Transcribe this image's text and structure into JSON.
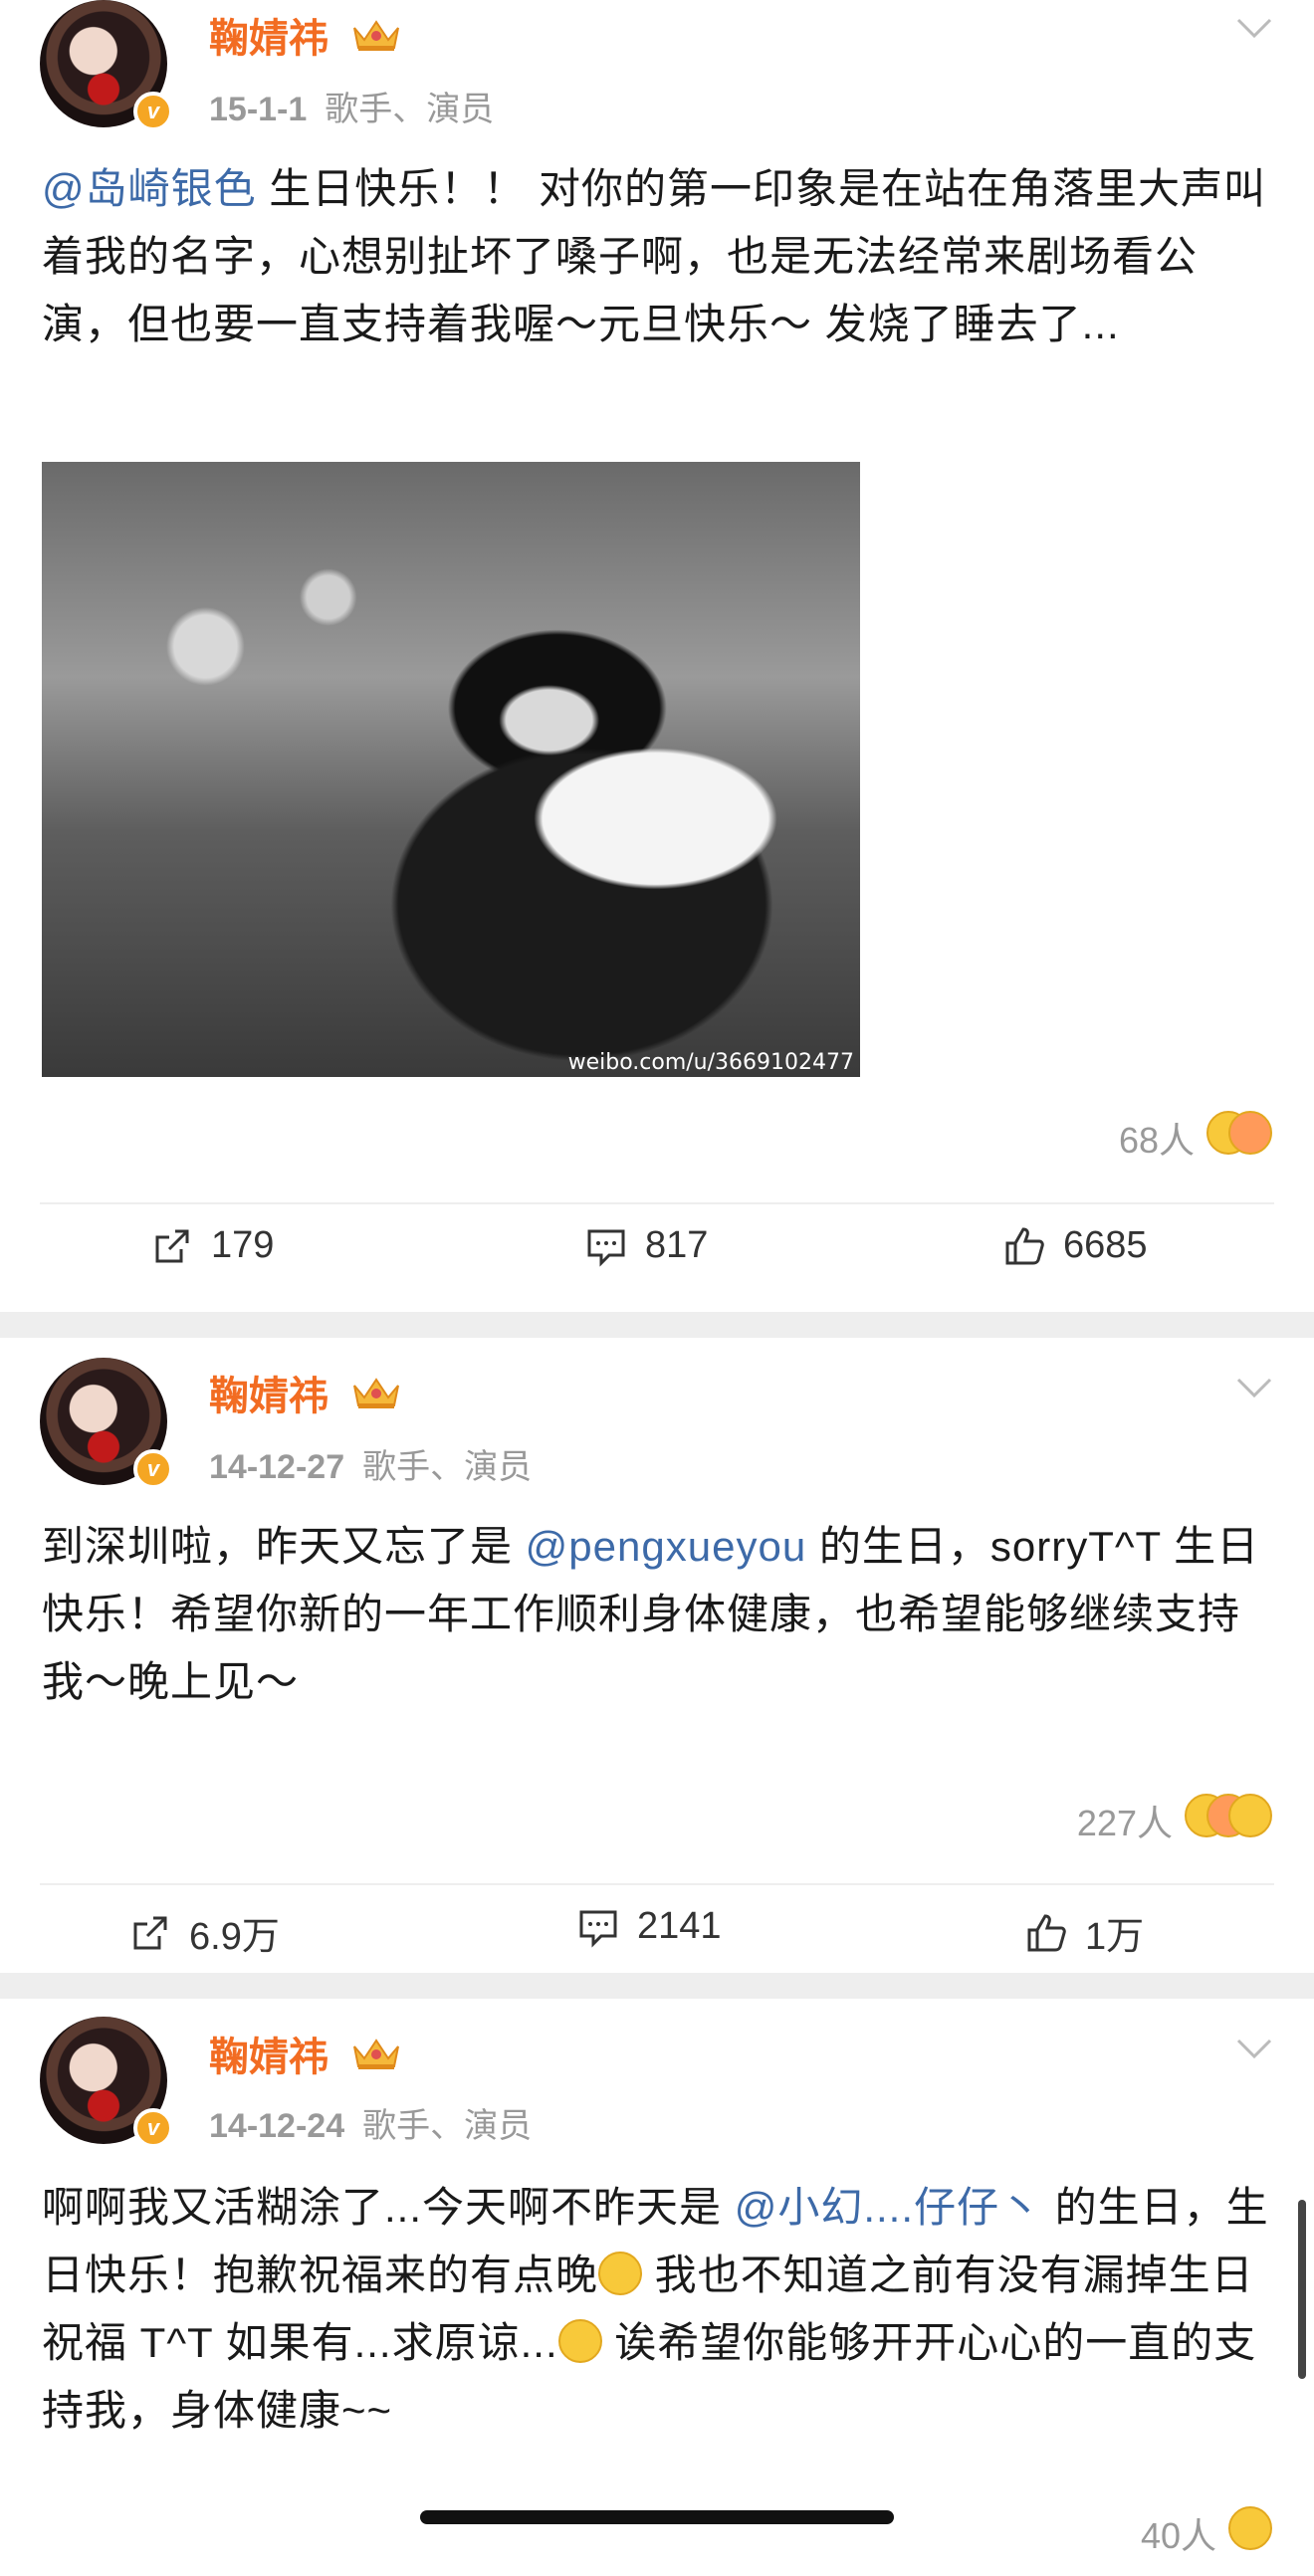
{
  "posts": [
    {
      "username": "鞠婧祎",
      "date": "15-1-1",
      "tags": "歌手、演员",
      "content_mention": "@岛崎银色",
      "content_text": " 生日快乐！！ 对你的第一印象是在站在角落里大声叫着我的名字，心想别扯坏了嗓子啊，也是无法经常来剧场看公演，但也要一直支持着我喔～元旦快乐～ 发烧了睡去了...",
      "image_watermark": "weibo.com/u/3669102477",
      "reaction_count": "68人",
      "repost_count": "179",
      "comment_count": "817",
      "like_count": "6685"
    },
    {
      "username": "鞠婧祎",
      "date": "14-12-27",
      "tags": "歌手、演员",
      "content_before": "到深圳啦，昨天又忘了是 ",
      "content_mention": "@pengxueyou",
      "content_after": " 的生日，sorryT^T  生日快乐！希望你新的一年工作顺利身体健康，也希望能够继续支持我～晚上见～",
      "reaction_count": "227人",
      "repost_count": "6.9万",
      "comment_count": "2141",
      "like_count": "1万"
    },
    {
      "username": "鞠婧祎",
      "date": "14-12-24",
      "tags": "歌手、演员",
      "content_before": "啊啊我又活糊涂了...今天啊不昨天是 ",
      "content_mention": "@小幻....仔仔丶",
      "content_after1": "  的生日，生日快乐！抱歉祝福来的有点晚",
      "content_after2": " 我也不知道之前有没有漏掉生日祝福 T^T  如果有...求原谅...",
      "content_after3": " 诶希望你能够开开心心的一直的支持我，身体健康~~",
      "reaction_count": "40人"
    }
  ],
  "colors": {
    "username": "#f26c22",
    "mention": "#3d6aa8",
    "meta": "#999999",
    "vip_badge": "#f5a623"
  },
  "icons": [
    "crown-icon",
    "chevron-down-icon",
    "repost-icon",
    "comment-icon",
    "like-icon",
    "verified-badge-icon",
    "emoji-icon"
  ]
}
